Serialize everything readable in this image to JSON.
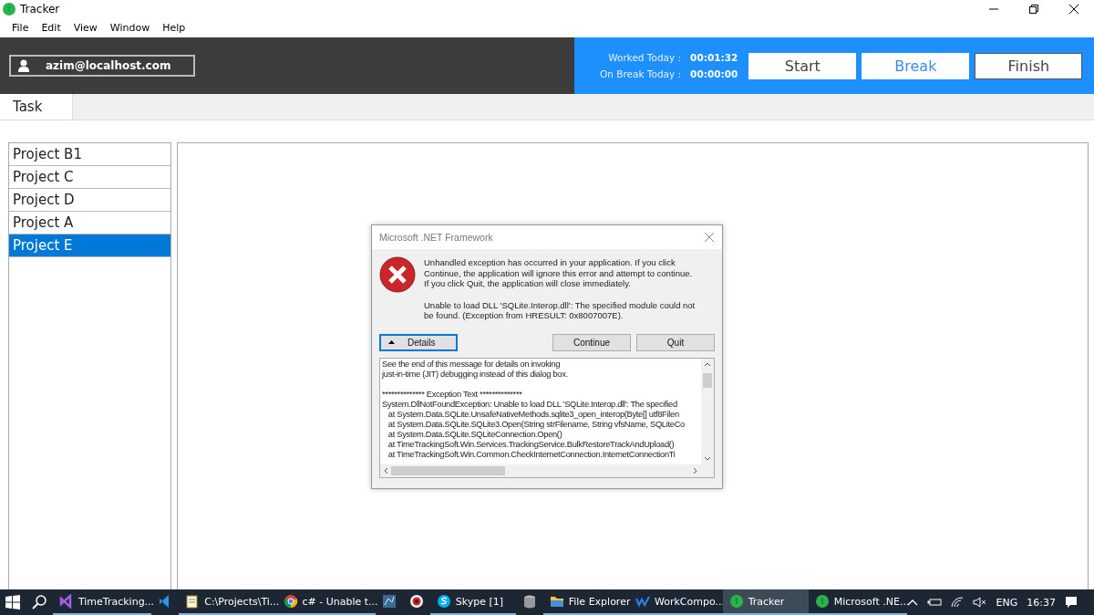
{
  "window": {
    "title": "Tracker"
  },
  "menu": [
    "File",
    "Edit",
    "View",
    "Window",
    "Help"
  ],
  "header": {
    "user": "azim@localhost.com",
    "stats": [
      {
        "label": "Worked Today :",
        "value": "00:01:32"
      },
      {
        "label": "On Break Today :",
        "value": "00:00:00"
      }
    ],
    "buttons": [
      {
        "label": "Start",
        "hovered": false,
        "focused": false
      },
      {
        "label": "Break",
        "hovered": true,
        "focused": false
      },
      {
        "label": "Finish",
        "hovered": false,
        "focused": true
      }
    ]
  },
  "tabs": [
    {
      "label": "Task",
      "selected": true
    }
  ],
  "projects": [
    {
      "label": "Project B1",
      "selected": false
    },
    {
      "label": "Project C",
      "selected": false
    },
    {
      "label": "Project D",
      "selected": false
    },
    {
      "label": "Project A",
      "selected": false
    },
    {
      "label": "Project E",
      "selected": true
    }
  ],
  "dialog": {
    "title": "Microsoft .NET Framework",
    "message": "Unhandled exception has occurred in your application. If you click Continue, the application will ignore this error and attempt to continue. If you click Quit, the application will close immediately.",
    "detail_message": "Unable to load DLL 'SQLite.Interop.dll': The specified module could not be found. (Exception from HRESULT: 0x8007007E).",
    "buttons": [
      {
        "label": "Details",
        "kind": "toggle",
        "focused": true
      },
      {
        "label": "Continue",
        "kind": "plain",
        "focused": false
      },
      {
        "label": "Quit",
        "kind": "plain",
        "focused": false
      }
    ],
    "details_intro": [
      "See the end of this message for details on invoking",
      "just-in-time (JIT) debugging instead of this dialog box."
    ],
    "details_lines": [
      "************** Exception Text **************",
      "System.DllNotFoundException: Unable to load DLL 'SQLite.Interop.dll': The specified",
      "   at System.Data.SQLite.UnsafeNativeMethods.sqlite3_open_interop(Byte[] utf8Filen",
      "   at System.Data.SQLite.SQLite3.Open(String strFilename, String vfsName, SQLiteCo",
      "   at System.Data.SQLite.SQLiteConnection.Open()",
      "   at TimeTrackingSoft.Win.Services.TrackingService.BulkRestoreTrackAndUpload()",
      "   at TimeTrackingSoft.Win.Common.CheckInternetConnection.InternetConnectionTi"
    ]
  },
  "taskbar": {
    "apps": [
      {
        "label": "TimeTracking...",
        "running": true,
        "active": false
      },
      {
        "running": false,
        "active": false
      },
      {
        "label": "C:\\Projects\\Ti...",
        "running": true,
        "active": false
      },
      {
        "label": "c# - Unable t...",
        "running": true,
        "active": false
      },
      {
        "running": false,
        "active": false
      },
      {
        "running": false,
        "active": false
      },
      {
        "label": "Skype [1]",
        "running": true,
        "active": false
      },
      {
        "running": false,
        "active": false
      },
      {
        "label": "File Explorer",
        "running": true,
        "active": false
      },
      {
        "label": "WorkCompo...",
        "running": true,
        "active": false
      },
      {
        "label": "Tracker",
        "running": true,
        "active": true
      },
      {
        "label": "Microsoft .NE...",
        "running": true,
        "active": false
      }
    ],
    "language": "ENG",
    "time": "16:37"
  }
}
